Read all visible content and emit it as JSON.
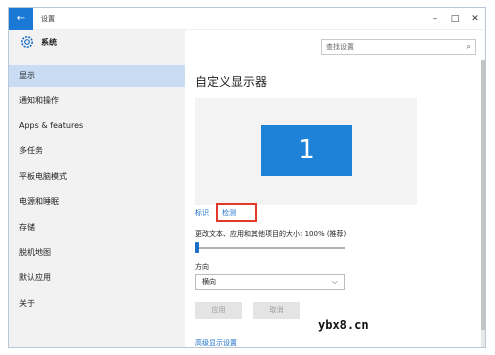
{
  "window": {
    "title": "设置",
    "back_glyph": "←",
    "minimize_glyph": "–",
    "maximize_glyph": "□",
    "close_glyph": "✕"
  },
  "sidebar": {
    "header": "系统",
    "items": [
      {
        "label": "显示",
        "active": true
      },
      {
        "label": "通知和操作"
      },
      {
        "label": "Apps & features"
      },
      {
        "label": "多任务"
      },
      {
        "label": "平板电脑模式"
      },
      {
        "label": "电源和睡眠"
      },
      {
        "label": "存储"
      },
      {
        "label": "脱机地图"
      },
      {
        "label": "默认应用"
      },
      {
        "label": "关于"
      }
    ]
  },
  "search": {
    "placeholder": "查找设置",
    "icon": "search-icon"
  },
  "main": {
    "title": "自定义显示器",
    "monitor_number": "1",
    "identify_link": "标识",
    "detect_link": "检测",
    "scale_label": "更改文本、应用和其他项目的大小: 100% (推荐)",
    "scale_percent": 100,
    "orientation_label": "方向",
    "orientation_value": "横向",
    "apply_button": "应用",
    "cancel_button": "取消",
    "advanced_link": "高级显示设置"
  },
  "watermark": "ybx8.cn",
  "colors": {
    "accent": "#1979d4",
    "monitor": "#1e83d8",
    "highlight_box": "#e23a2a",
    "active_nav": "#c8ddf4"
  }
}
